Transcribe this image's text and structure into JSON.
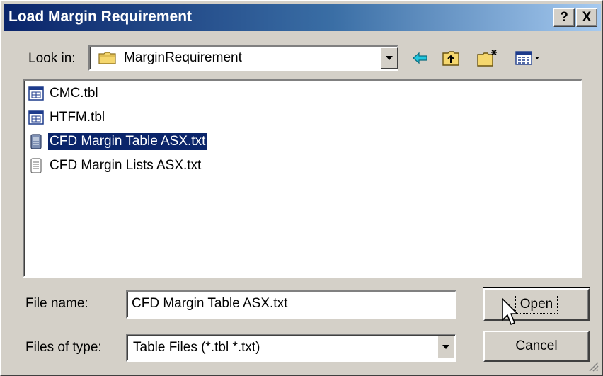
{
  "window": {
    "title": "Load Margin Requirement",
    "help_label": "?",
    "close_label": "X"
  },
  "look_in": {
    "label": "Look in:",
    "value": "MarginRequirement",
    "icon": "folder-icon"
  },
  "toolbar": {
    "icons": [
      "back-arrow-icon",
      "up-folder-icon",
      "new-folder-icon",
      "view-menu-icon"
    ]
  },
  "files": [
    {
      "name": "CMC.tbl",
      "icon": "table-file-icon",
      "selected": false
    },
    {
      "name": "HTFM.tbl",
      "icon": "table-file-icon",
      "selected": false
    },
    {
      "name": "CFD Margin Table ASX.txt",
      "icon": "text-file-icon",
      "selected": true
    },
    {
      "name": "CFD Margin Lists ASX.txt",
      "icon": "text-file-icon",
      "selected": false
    }
  ],
  "file_name": {
    "label": "File name:",
    "value": "CFD Margin Table ASX.txt"
  },
  "file_type": {
    "label": "Files of type:",
    "value": "Table Files (*.tbl *.txt)"
  },
  "buttons": {
    "open": "Open",
    "cancel": "Cancel"
  },
  "colors": {
    "title_start": "#0a246a",
    "title_end": "#a6caf0",
    "face": "#d4d0c8",
    "selection": "#0a246a"
  }
}
